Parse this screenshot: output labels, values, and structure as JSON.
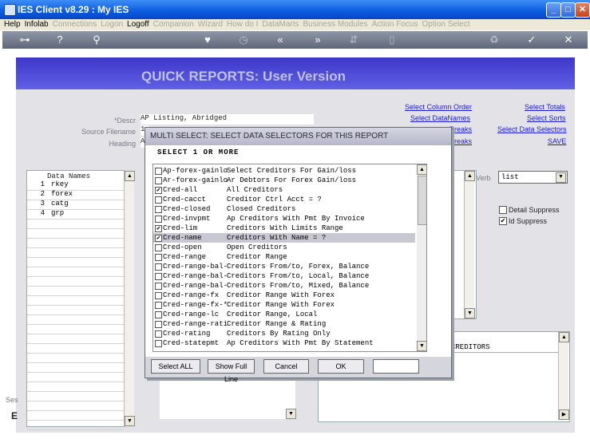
{
  "window": {
    "title": "IES Client v8.29 : My IES"
  },
  "menu": [
    {
      "label": "Help",
      "enabled": true
    },
    {
      "label": "Infolab",
      "enabled": true
    },
    {
      "label": "Connections",
      "enabled": false
    },
    {
      "label": "Logon",
      "enabled": false
    },
    {
      "label": "Logoff",
      "enabled": true
    },
    {
      "label": "Companion",
      "enabled": false
    },
    {
      "label": "Wizard",
      "enabled": false
    },
    {
      "label": "How do I",
      "enabled": false
    },
    {
      "label": "DataMarts",
      "enabled": false
    },
    {
      "label": "Business Modules",
      "enabled": false
    },
    {
      "label": "Action Focus",
      "enabled": false
    },
    {
      "label": "Option Select",
      "enabled": false
    }
  ],
  "page": {
    "title": "QUICK REPORTS: User Version"
  },
  "form": {
    "descr_label": "*Descr",
    "descr_value": "AP Listing, Abridged",
    "source_label": "Source Filename",
    "source_value": "1",
    "heading_label": "Heading",
    "heading_value": "A"
  },
  "links": {
    "select_column_order": "Select Column Order",
    "select_datanames": "Select DataNames",
    "breaks1": "Breaks",
    "breaks2": "Breaks",
    "select_totals": "Select Totals",
    "select_sorts": "Select Sorts",
    "select_data_selectors": "Select Data Selectors",
    "save": "SAVE"
  },
  "datanames": {
    "header": "Data Names",
    "rows": [
      {
        "n": "1",
        "name": "rkey"
      },
      {
        "n": "2",
        "name": "forex"
      },
      {
        "n": "3",
        "name": "catg"
      },
      {
        "n": "4",
        "name": "grp"
      }
    ]
  },
  "verb": {
    "label": "Verb",
    "value": "list"
  },
  "options": {
    "detail_suppress": {
      "label": "Detail Suppress",
      "checked": false
    },
    "id_suppress": {
      "label": "Id Suppress",
      "checked": true
    }
  },
  "lower_right": {
    "value": "CREDITORS"
  },
  "dialog": {
    "title": "MULTI SELECT: SELECT DATA SELECTORS FOR THIS REPORT",
    "subtitle": "SELECT 1 OR MORE",
    "items": [
      {
        "code": "Ap-forex-gainlo",
        "desc": "Select Creditors For Gain/loss",
        "checked": false,
        "selected": false
      },
      {
        "code": "Ar-forex-gainlo",
        "desc": "Ar Debtors For Forex Gain/loss",
        "checked": false,
        "selected": false
      },
      {
        "code": "Cred-all",
        "desc": "All Creditors",
        "checked": true,
        "selected": false
      },
      {
        "code": "Cred-cacct",
        "desc": "Creditor Ctrl Acct = ?",
        "checked": false,
        "selected": false
      },
      {
        "code": "Cred-closed",
        "desc": "Closed Creditors",
        "checked": false,
        "selected": false
      },
      {
        "code": "Cred-invpmt",
        "desc": "Ap Creditors With Pmt By Invoice",
        "checked": false,
        "selected": false
      },
      {
        "code": "Cred-lim",
        "desc": "Creditors With Limits Range",
        "checked": true,
        "selected": false
      },
      {
        "code": "Cred-name",
        "desc": "Creditors With Name = ?",
        "checked": true,
        "selected": true
      },
      {
        "code": "Cred-open",
        "desc": "Open Creditors",
        "checked": false,
        "selected": false
      },
      {
        "code": "Cred-range",
        "desc": "Creditor Range",
        "checked": false,
        "selected": false
      },
      {
        "code": "Cred-range-bal-",
        "desc": "Creditors From/to, Forex, Balance",
        "checked": false,
        "selected": false
      },
      {
        "code": "Cred-range-bal-",
        "desc": "Creditors From/to, Local, Balance",
        "checked": false,
        "selected": false
      },
      {
        "code": "Cred-range-bal-",
        "desc": "Creditors From/to, Mixed, Balance",
        "checked": false,
        "selected": false
      },
      {
        "code": "Cred-range-fx",
        "desc": "Creditor Range With Forex",
        "checked": false,
        "selected": false
      },
      {
        "code": "Cred-range-fx-*",
        "desc": "Creditor Range With Forex",
        "checked": false,
        "selected": false
      },
      {
        "code": "Cred-range-lc",
        "desc": "Creditor Range, Local",
        "checked": false,
        "selected": false
      },
      {
        "code": "Cred-range-rati",
        "desc": "Creditor Range & Rating",
        "checked": false,
        "selected": false
      },
      {
        "code": "Cred-rating",
        "desc": "Creditors By Rating Only",
        "checked": false,
        "selected": false
      },
      {
        "code": "Cred-statepmt",
        "desc": "Ap Creditors With Pmt By Statement",
        "checked": false,
        "selected": false
      }
    ],
    "buttons": {
      "select_all": "Select ALL",
      "show_full_line": "Show Full Line",
      "cancel": "Cancel",
      "ok": "OK"
    },
    "input_value": ""
  },
  "cut_labels": {
    "ses": "Ses",
    "e": "E"
  }
}
